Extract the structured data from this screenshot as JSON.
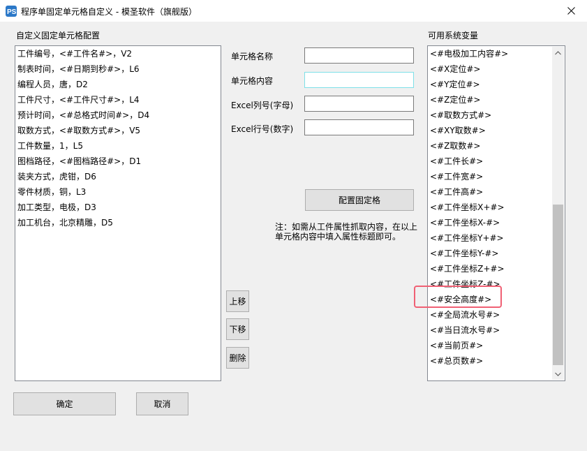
{
  "window": {
    "title": "程序单固定单元格自定义 - 模圣软件（旗舰版）",
    "icon": "app-logo-icon",
    "close_icon": "close-icon"
  },
  "left_panel": {
    "label": "自定义固定单元格配置",
    "items": [
      "工件编号，<#工件名#>，V2",
      "制表时间，<#日期到秒#>，L6",
      "编程人员，唐，D2",
      "工件尺寸，<#工件尺寸#>，L4",
      "预计时间，<#总格式时间#>，D4",
      "取数方式，<#取数方式#>，V5",
      "工件数量，1，L5",
      "图档路径，<#图档路径#>，D1",
      "装夹方式，虎钳，D6",
      "零件材质，铜，L3",
      "加工类型，电极，D3",
      "加工机台，北京精雕，D5"
    ]
  },
  "form": {
    "cell_name_label": "单元格名称",
    "cell_content_label": "单元格内容",
    "excel_col_label": "Excel列号(字母)",
    "excel_row_label": "Excel行号(数字)",
    "cell_name_value": "",
    "cell_content_value": "",
    "excel_col_value": "",
    "excel_row_value": "",
    "configure_button": "配置固定格",
    "note": "注：如需从工件属性抓取内容，在以上单元格内容中填入属性标题即可。"
  },
  "move_buttons": {
    "up": "上移",
    "down": "下移",
    "delete": "删除"
  },
  "right_panel": {
    "label": "可用系统变量",
    "items": [
      "<#电极加工内容#>",
      "<#X定位#>",
      "<#Y定位#>",
      "<#Z定位#>",
      "<#取数方式#>",
      "<#XY取数#>",
      "<#Z取数#>",
      "<#工件长#>",
      "<#工件宽#>",
      "<#工件高#>",
      "<#工件坐标X+#>",
      "<#工件坐标X-#>",
      "<#工件坐标Y+#>",
      "<#工件坐标Y-#>",
      "<#工件坐标Z+#>",
      "<#工件坐标Z-#>",
      "<#安全高度#>",
      "<#全局流水号#>",
      "<#当日流水号#>",
      "<#当前页#>",
      "<#总页数#>"
    ],
    "highlighted_item": "<#安全高度#>",
    "highlight_color": "#f06074"
  },
  "footer": {
    "ok": "确定",
    "cancel": "取消"
  }
}
